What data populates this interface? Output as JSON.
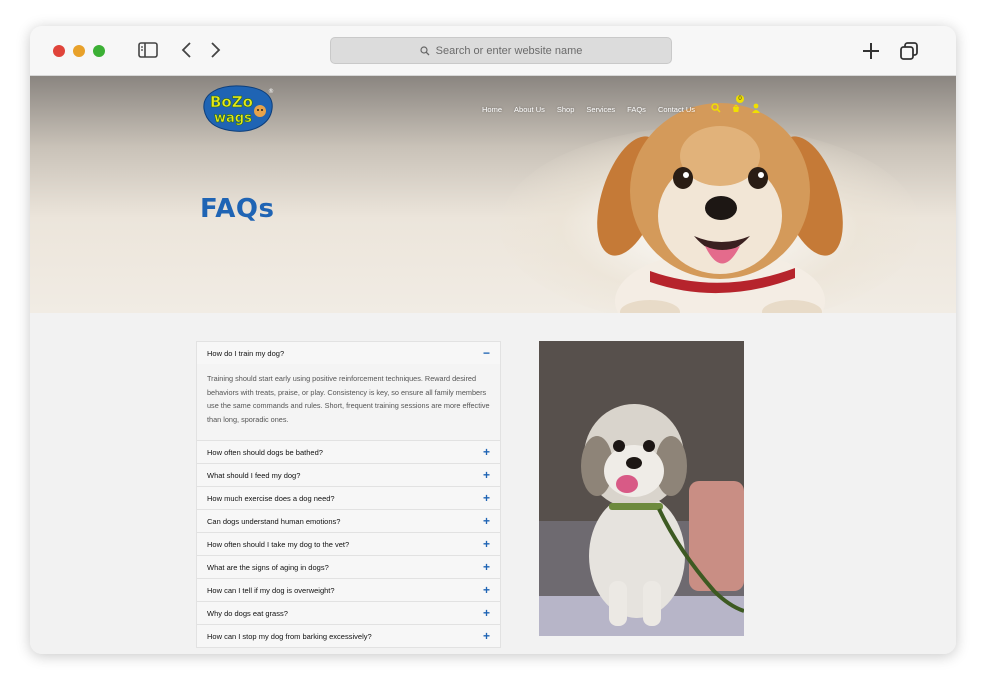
{
  "browser": {
    "address_placeholder": "Search or enter website name"
  },
  "site": {
    "logo_text": "Bozo Wags",
    "logo_mark": "®",
    "nav": [
      "Home",
      "About Us",
      "Shop",
      "Services",
      "FAQs",
      "Contact Us"
    ],
    "cart_count": "0",
    "colors": {
      "brand_blue": "#1f64b4",
      "accent_yellow": "#f0e000"
    }
  },
  "hero": {
    "title": "FAQs"
  },
  "faq": {
    "items": [
      {
        "question": "How do I train my dog?",
        "expanded": true,
        "toggle": "−",
        "answer": "Training should start early using positive reinforcement techniques. Reward desired behaviors with treats, praise, or play. Consistency is key, so ensure all family members use the same commands and rules. Short, frequent training sessions are more effective than long, sporadic ones."
      },
      {
        "question": "How often should dogs be bathed?",
        "expanded": false,
        "toggle": "+"
      },
      {
        "question": "What should I feed my dog?",
        "expanded": false,
        "toggle": "+"
      },
      {
        "question": "How much exercise does a dog need?",
        "expanded": false,
        "toggle": "+"
      },
      {
        "question": "Can dogs understand human emotions?",
        "expanded": false,
        "toggle": "+"
      },
      {
        "question": "How often should I take my dog to the vet?",
        "expanded": false,
        "toggle": "+"
      },
      {
        "question": "What are the signs of aging in dogs?",
        "expanded": false,
        "toggle": "+"
      },
      {
        "question": "How can I tell if my dog is overweight?",
        "expanded": false,
        "toggle": "+"
      },
      {
        "question": "Why do dogs eat grass?",
        "expanded": false,
        "toggle": "+"
      },
      {
        "question": "How can I stop my dog from barking excessively?",
        "expanded": false,
        "toggle": "+"
      }
    ]
  }
}
